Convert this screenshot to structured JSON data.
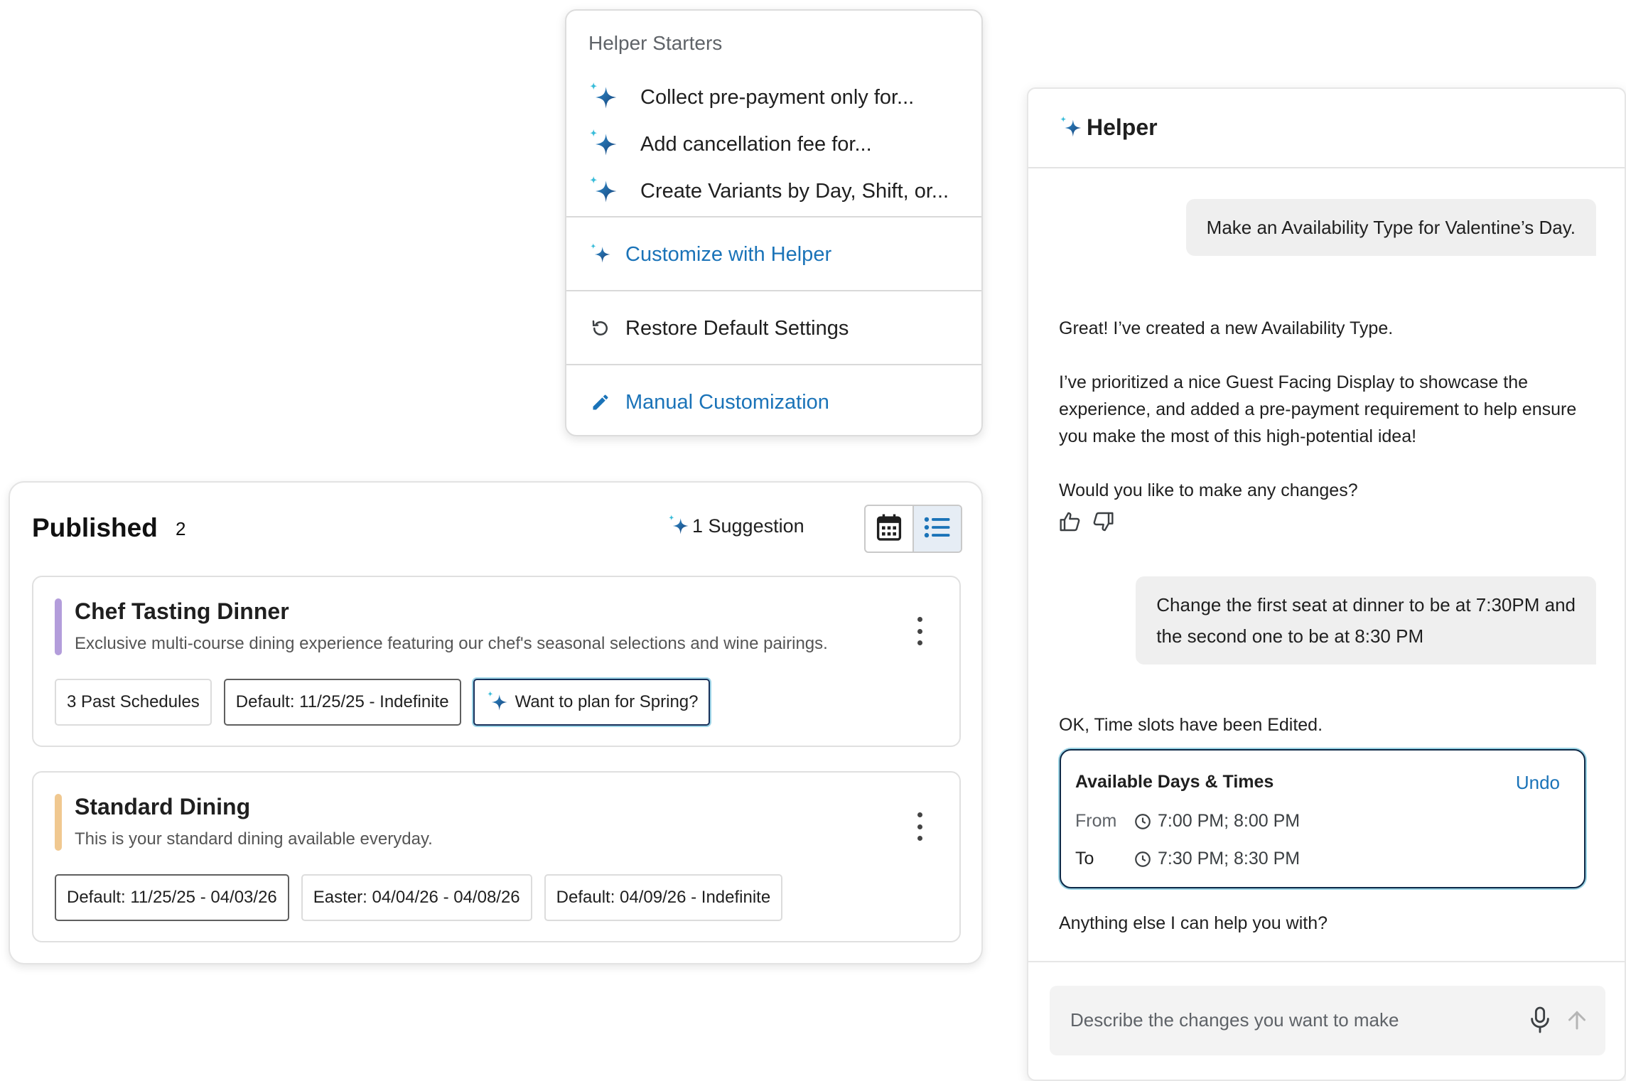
{
  "menu": {
    "heading": "Helper Starters",
    "starters": [
      "Collect pre-payment only for...",
      "Add cancellation fee for...",
      "Create Variants by Day, Shift, or..."
    ],
    "customize_label": "Customize with Helper",
    "restore_label": "Restore Default Settings",
    "manual_label": "Manual Customization"
  },
  "published": {
    "title": "Published",
    "count": "2",
    "suggestion_label": "1 Suggestion",
    "experiences": [
      {
        "title": "Chef Tasting Dinner",
        "description": "Exclusive multi-course dining experience featuring our chef's seasonal selections and wine pairings.",
        "accent": "#b39ddb",
        "chips": [
          "3 Past Schedules",
          "Default: 11/25/25 - Indefinite",
          "Want to plan for Spring?"
        ]
      },
      {
        "title": "Standard Dining",
        "description": "This is your standard dining available everyday.",
        "accent": "#f0c890",
        "chips": [
          "Default: 11/25/25 - 04/03/26",
          "Easter: 04/04/26 - 04/08/26",
          "Default: 04/09/26 - Indefinite"
        ]
      }
    ]
  },
  "helper": {
    "title": "Helper",
    "messages": {
      "user1": "Make an Availability Type for Valentine’s Day.",
      "bot1_p1": "Great! I’ve created a new Availability Type.",
      "bot1_p2_l1": "I’ve prioritized a nice Guest Facing Display to showcase the",
      "bot1_p2_l2": "experience, and added a pre-payment requirement to help ensure",
      "bot1_p2_l3": "you make the most of this high-potential idea!",
      "bot1_p3": "Would you like to make any changes?",
      "user2_l1": "Change the first seat at dinner to be at 7:30PM and",
      "user2_l2": "the second one to be at 8:30 PM",
      "bot2": "OK, Time slots have been Edited.",
      "bot3": "Anything else I can help you with?"
    },
    "times_card": {
      "title": "Available Days & Times",
      "undo_label": "Undo",
      "from_label": "From",
      "from_value": "7:00 PM; 8:00 PM",
      "to_label": "To",
      "to_value": "7:30 PM; 8:30 PM"
    },
    "input_placeholder": "Describe the changes you want to make"
  },
  "icons": {
    "sparkle": "sparkle-icon",
    "restore": "restore-icon",
    "pencil": "pencil-icon",
    "calendar": "calendar-icon",
    "list": "list-icon",
    "kebab": "kebab-menu-icon",
    "thumbs_up": "thumbs-up-icon",
    "thumbs_down": "thumbs-down-icon",
    "clock": "clock-icon",
    "mic": "microphone-icon",
    "send": "send-arrow-icon"
  },
  "colors": {
    "accent_blue": "#1a73b8",
    "sparkle_dark": "#1d4d86",
    "sparkle_light": "#39b9d8"
  }
}
